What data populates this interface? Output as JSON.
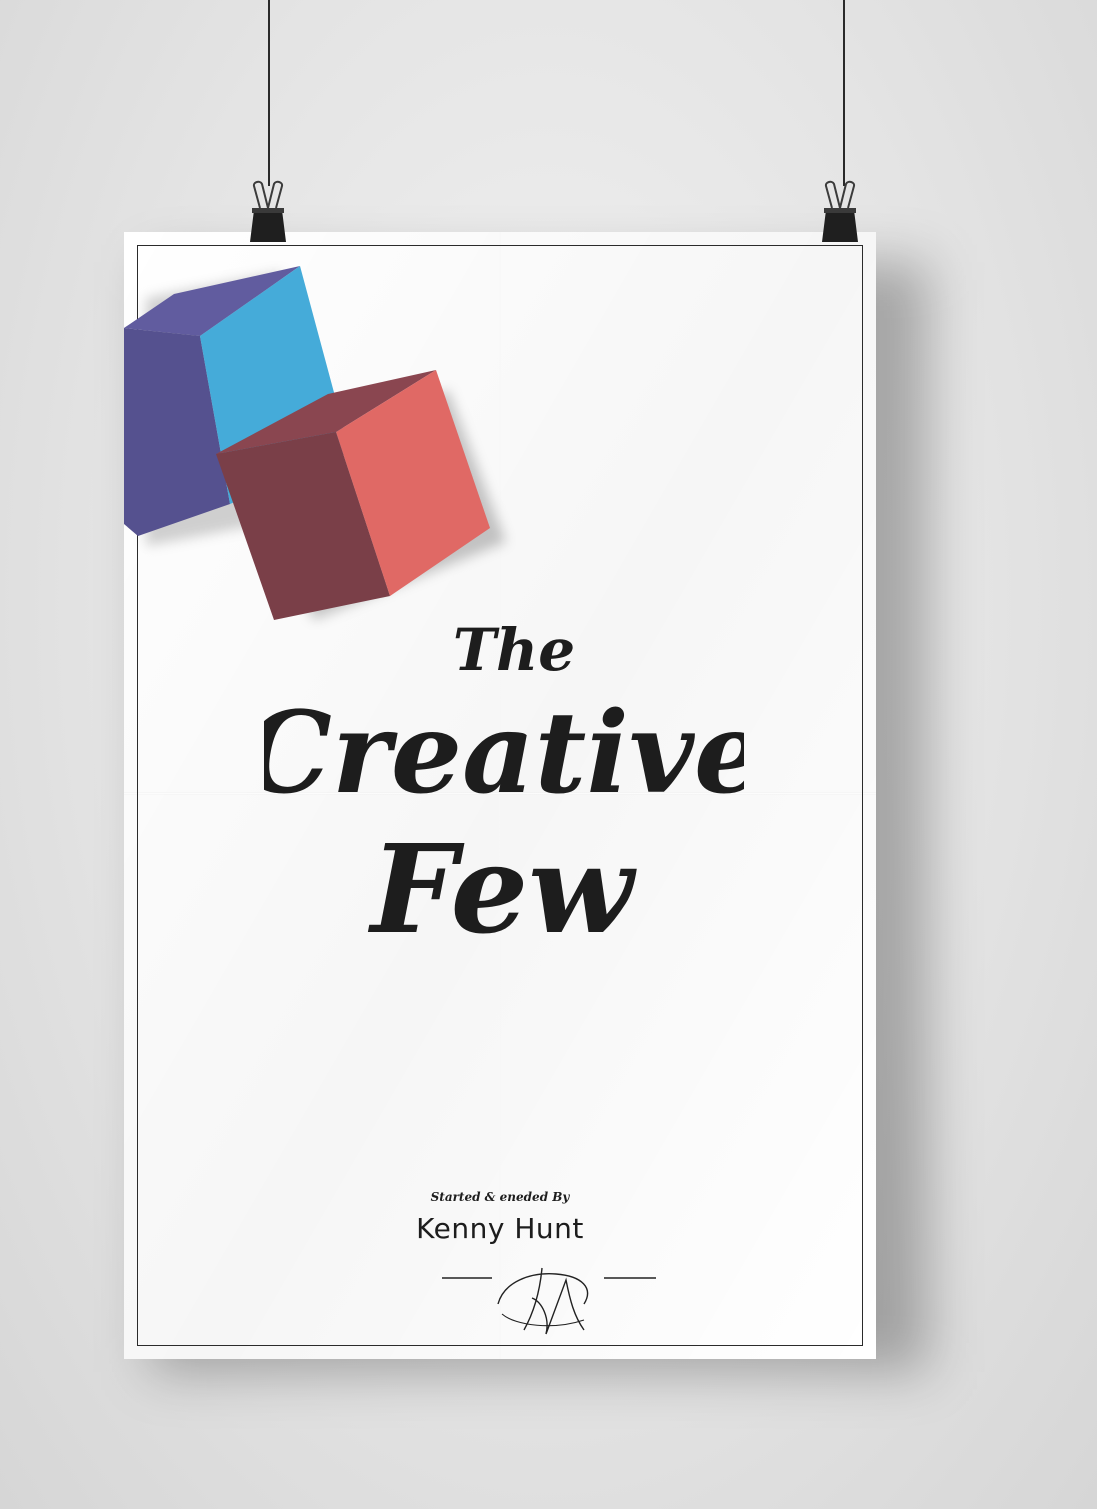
{
  "poster": {
    "title_line1": "The",
    "title_line2": "Creative",
    "title_line3": "Few",
    "byline": "Started & eneded By",
    "author": "Kenny Hunt"
  },
  "colors": {
    "cube_top_left": "#5e5a9e",
    "cube_blue_face": "#45abd9",
    "cube_purple_face": "#55518f",
    "cube_red_top": "#7e3a45",
    "cube_red_left": "#7a3f48",
    "cube_red_right": "#e06965",
    "title_ink": "#1d1d1d"
  },
  "icons": {
    "clips": "binder-clip-icon",
    "signature": "signature-mark"
  }
}
